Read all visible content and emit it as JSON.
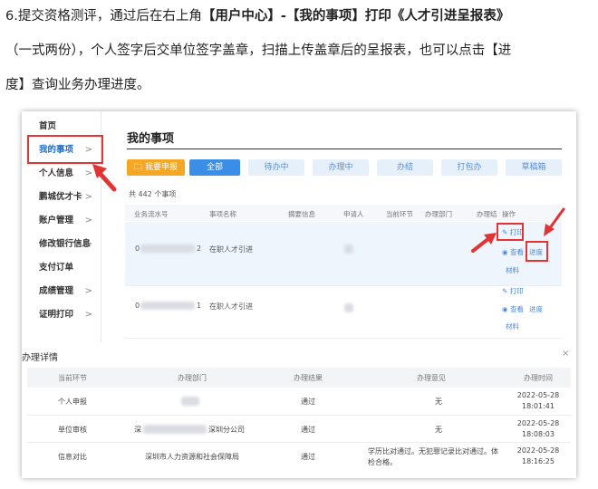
{
  "instructions": {
    "line1_pre": "6.提交资格测评，通过后在右上角",
    "line1_bold1": "【用户中心】-【我的事项】",
    "line1_bold2": "打印《人才引进呈报表》",
    "line2": "（一式两份），个人签字后交单位签字盖章，扫描上传盖章后的呈报表，也可以点击【进",
    "line3": "度】查询业务办理进度。"
  },
  "sidebar": {
    "items": [
      {
        "label": "首页",
        "chevron": ""
      },
      {
        "label": "我的事项",
        "chevron": ">"
      },
      {
        "label": "个人信息",
        "chevron": ">"
      },
      {
        "label": "鹏城优才卡",
        "chevron": ">"
      },
      {
        "label": "账户管理",
        "chevron": ">"
      },
      {
        "label": "修改银行信息",
        "chevron": ">"
      },
      {
        "label": "支付订单",
        "chevron": ""
      },
      {
        "label": "成绩管理",
        "chevron": ">"
      },
      {
        "label": "证明打印",
        "chevron": ">"
      }
    ]
  },
  "main": {
    "title": "我的事项",
    "tabs": [
      {
        "label": "我要申报",
        "icon": "folder-icon"
      },
      {
        "label": "全部"
      },
      {
        "label": "待办中"
      },
      {
        "label": "办理中"
      },
      {
        "label": "办结"
      },
      {
        "label": "打包办"
      },
      {
        "label": "草稿箱"
      }
    ],
    "count_text": "共 442 个事项",
    "columns": [
      "业务流水号",
      "事项名称",
      "摘要信息",
      "申请人",
      "当前环节",
      "办理部门",
      "办理结",
      "操作"
    ],
    "rows": [
      {
        "serial_prefix": "0",
        "serial_suffix": "2",
        "item_name": "在职人才引进"
      },
      {
        "serial_prefix": "0",
        "serial_suffix": "1",
        "item_name": "在职人才引进"
      }
    ],
    "ops": {
      "print": "打印",
      "view": "查看",
      "progress": "进度",
      "materials": "材料"
    }
  },
  "details": {
    "title": "办理详情",
    "close": "×",
    "columns": [
      "当前环节",
      "办理部门",
      "办理结果",
      "办理意见",
      "办理时间"
    ],
    "rows": [
      {
        "step": "个人申报",
        "dept": "",
        "result": "通过",
        "opinion": "无",
        "date": "2022-05-28",
        "time": "18:01:41"
      },
      {
        "step": "单位审核",
        "dept_prefix": "深",
        "dept_suffix": "深圳分公司",
        "result": "通过",
        "opinion": "无",
        "date": "2022-05-28",
        "time": "18:08:03"
      },
      {
        "step": "信息对比",
        "dept": "深圳市人力资源和社会保障局",
        "result": "通过",
        "opinion": "学历比对通过。无犯罪记录比对通过。体检合格。",
        "date": "2022-05-28",
        "time": "18:16:25"
      }
    ]
  },
  "colors": {
    "accent": "#3a8ee6",
    "highlight": "#e23434",
    "orange": "#f5a623"
  }
}
